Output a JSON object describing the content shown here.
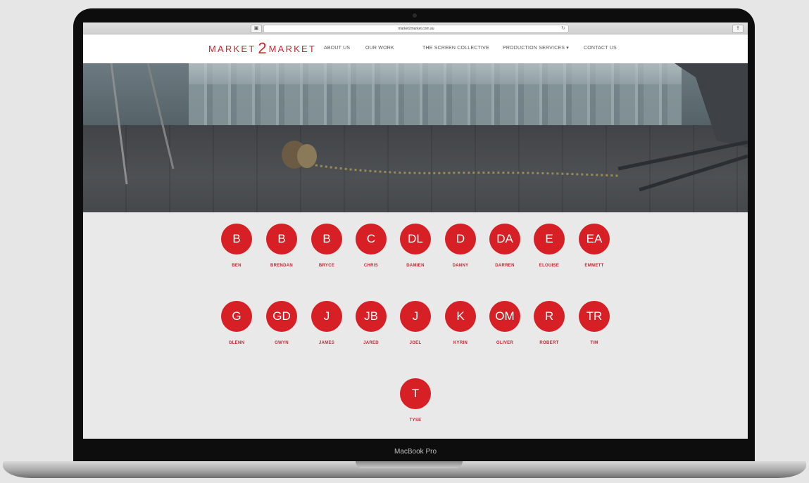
{
  "browser": {
    "url": "market2market.com.au"
  },
  "device": {
    "label": "MacBook Pro"
  },
  "site": {
    "logo_left": "MARKET",
    "logo_mid": "2",
    "logo_right": "MARKET",
    "nav": [
      "ABOUT US",
      "OUR WORK",
      "THE SCREEN COLLECTIVE",
      "PRODUCTION SERVICES ▾",
      "CONTACT US"
    ]
  },
  "profiles": [
    {
      "initials": "B",
      "name": "BEN"
    },
    {
      "initials": "B",
      "name": "BRENDAN"
    },
    {
      "initials": "B",
      "name": "BRYCE"
    },
    {
      "initials": "C",
      "name": "CHRIS"
    },
    {
      "initials": "DL",
      "name": "DAMIEN"
    },
    {
      "initials": "D",
      "name": "DANNY"
    },
    {
      "initials": "DA",
      "name": "DARREN"
    },
    {
      "initials": "E",
      "name": "ELOUISE"
    },
    {
      "initials": "EA",
      "name": "EMMETT"
    },
    {
      "initials": "G",
      "name": "GLENN"
    },
    {
      "initials": "GD",
      "name": "GWYN"
    },
    {
      "initials": "J",
      "name": "JAMES"
    },
    {
      "initials": "JB",
      "name": "JARED"
    },
    {
      "initials": "J",
      "name": "JOEL"
    },
    {
      "initials": "K",
      "name": "KYRIN"
    },
    {
      "initials": "OM",
      "name": "OLIVER"
    },
    {
      "initials": "R",
      "name": "ROBERT"
    },
    {
      "initials": "TR",
      "name": "TIM"
    },
    {
      "initials": "T",
      "name": "TYSE"
    }
  ],
  "colors": {
    "brand_red": "#d71f26"
  }
}
